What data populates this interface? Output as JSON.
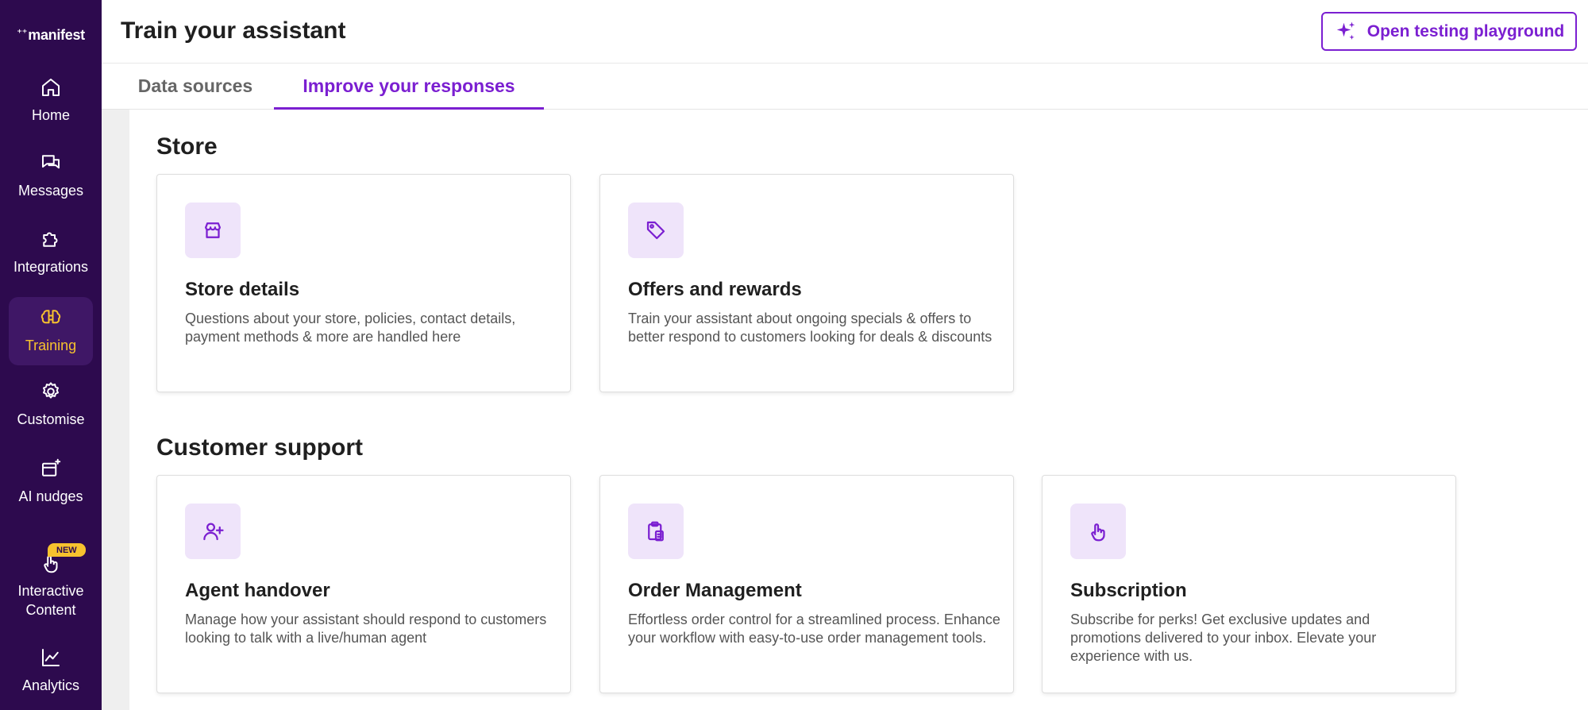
{
  "app": {
    "logo_text": "manifest"
  },
  "sidebar": {
    "items": [
      {
        "label": "Home",
        "icon": "home-icon"
      },
      {
        "label": "Messages",
        "icon": "messages-icon"
      },
      {
        "label": "Integrations",
        "icon": "puzzle-icon"
      },
      {
        "label": "Training",
        "icon": "brain-icon",
        "active": true
      },
      {
        "label": "Customise",
        "icon": "gear-icon"
      },
      {
        "label": "AI nudges",
        "icon": "ai-nudge-icon"
      },
      {
        "label": "Interactive Content",
        "icon": "pointer-hand-icon",
        "badge": "NEW"
      },
      {
        "label": "Analytics",
        "icon": "chart-line-icon"
      }
    ]
  },
  "header": {
    "title": "Train your assistant",
    "playground_button": "Open testing playground"
  },
  "tabs": [
    {
      "label": "Data sources",
      "active": false
    },
    {
      "label": "Improve your responses",
      "active": true
    }
  ],
  "sections": [
    {
      "title": "Store",
      "cards": [
        {
          "title": "Store details",
          "description": "Questions about your store, policies, contact details, payment methods & more are handled here",
          "icon": "store-icon"
        },
        {
          "title": "Offers and rewards",
          "description": "Train your assistant about ongoing specials & offers to better respond to customers looking for deals & discounts",
          "icon": "tag-icon"
        }
      ]
    },
    {
      "title": "Customer support",
      "cards": [
        {
          "title": "Agent handover",
          "description": "Manage how your assistant should respond to customers looking to talk with a live/human agent",
          "icon": "user-plus-icon"
        },
        {
          "title": "Order Management",
          "description": "Effortless order control for a streamlined process. Enhance your workflow with easy-to-use order management tools.",
          "icon": "clipboard-icon"
        },
        {
          "title": "Subscription",
          "description": "Subscribe for perks! Get exclusive updates and promotions delivered to your inbox. Elevate your experience with us.",
          "icon": "hand-pointer-icon"
        }
      ]
    }
  ],
  "colors": {
    "sidebar_bg": "#2d0a4e",
    "accent": "#7b1fd1",
    "active_nav": "#f7c22e",
    "icon_tile_bg": "#efe4fa"
  }
}
